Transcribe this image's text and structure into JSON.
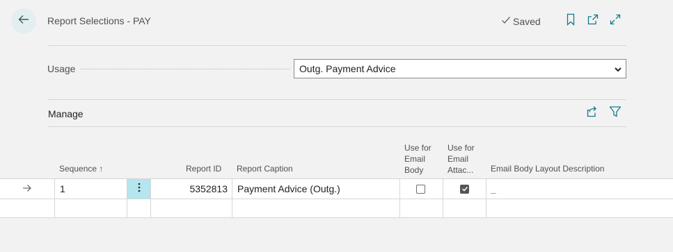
{
  "header": {
    "title": "Report Selections - PAY",
    "saved_label": "Saved"
  },
  "usage": {
    "label": "Usage",
    "value": "Outg. Payment Advice"
  },
  "manage": {
    "label": "Manage"
  },
  "table": {
    "columns": {
      "sequence": "Sequence ↑",
      "report_id": "Report ID",
      "report_caption": "Report Caption",
      "use_email_body": [
        "Use for",
        "Email",
        "Body"
      ],
      "use_email_attach": [
        "Use for",
        "Email",
        "Attac..."
      ],
      "email_body_layout": "Email Body Layout Description"
    },
    "rows": [
      {
        "sequence": "1",
        "report_id": "5352813",
        "report_caption": "Payment Advice (Outg.)",
        "use_email_body": false,
        "use_email_attach": true,
        "email_body_layout": "_"
      }
    ]
  },
  "icons": {
    "back": "arrow-left-icon",
    "saved": "checkmark-icon",
    "bookmark": "bookmark-icon",
    "open_new": "open-in-new-window-icon",
    "expand": "expand-icon",
    "share": "share-icon",
    "filter": "filter-icon",
    "row_arrow": "arrow-right-icon",
    "row_menu": "more-vertical-icon",
    "select_chevron": "chevron-down-icon"
  },
  "colors": {
    "accent": "#0f7b8a",
    "selected_cell": "#b5e5ee",
    "back_button_bg": "#e2eef0"
  }
}
